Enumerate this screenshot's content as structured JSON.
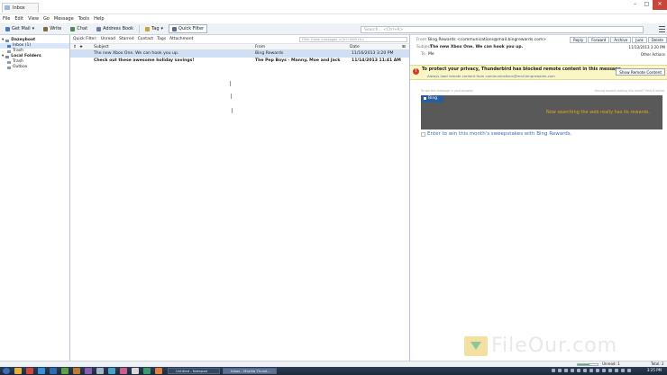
{
  "window": {
    "tab_title": "Inbox",
    "controls": [
      "–",
      "□",
      "✕"
    ]
  },
  "menu": [
    "File",
    "Edit",
    "View",
    "Go",
    "Message",
    "Tools",
    "Help"
  ],
  "toolbar": {
    "get_mail": "Get Mail",
    "write": "Write",
    "chat": "Chat",
    "address_book": "Address Book",
    "tag": "Tag",
    "quick_filter": "Quick Filter",
    "search_placeholder": "Search... <Ctrl+K>"
  },
  "folders": [
    {
      "label": "Dazeyboot",
      "indent": 0,
      "bold": true
    },
    {
      "label": "Inbox (1)",
      "indent": 1,
      "bold": false,
      "selected": true
    },
    {
      "label": "Trash",
      "indent": 1,
      "bold": false
    },
    {
      "label": "Local Folders",
      "indent": 0,
      "bold": true
    },
    {
      "label": "Trash",
      "indent": 1,
      "bold": false
    },
    {
      "label": "Outbox",
      "indent": 1,
      "bold": false
    }
  ],
  "quick_filter": {
    "items": [
      "Quick Filter:",
      "Unread",
      "Starred",
      "Contact",
      "Tags",
      "Attachment"
    ],
    "filter_placeholder": "Filter these messages <Ctrl+Shift+K>"
  },
  "columns": {
    "subject": "Subject",
    "from": "From",
    "date": "Date"
  },
  "messages": [
    {
      "subject": "The new Xbox One. We can hook you up.",
      "from": "Bing Rewards",
      "date": "11/16/2013 3:20 PM",
      "selected": true,
      "bold": false
    },
    {
      "subject": "Check out these awesome holiday savings!",
      "from": "The Pep Boys - Manny, Moe and Jack",
      "date": "11/14/2013 11:41 AM",
      "selected": false,
      "bold": true
    }
  ],
  "preview": {
    "from_label": "From",
    "from_value": "Bing Rewards <communications@mail.bingrewards.com>",
    "date": "11/13/2013 3:20 PM",
    "subject_label": "Subject",
    "subject_value": "The new Xbox One. We can hook you up.",
    "to_label": "To",
    "to_value": "Me",
    "other_actions": "Other Actions",
    "buttons": [
      "Reply",
      "Forward",
      "Archive",
      "Junk",
      "Delete"
    ],
    "notice_title": "To protect your privacy, Thunderbird has blocked remote content in this message.",
    "notice_sub": "Always load remote content from communications@mail.bingrewards.com",
    "show_remote": "Show Remote Content",
    "pre_left": "To see this message in your browser",
    "pre_right": "Having trouble reading this email? View it online",
    "logo_text": "Bing",
    "promo": "Now searching the web really has its rewards.",
    "enter": "Enter to win this month's sweepstakes with Bing Rewards."
  },
  "status": {
    "unread": "Unread: 1",
    "total": "Total: 2",
    "progress": 0.6
  },
  "taskbar": {
    "items": [
      "Untitled - Notepad",
      "Inbox - Mozilla Thund..."
    ],
    "time": "3:25 PM"
  },
  "watermark": "FileOur.com"
}
